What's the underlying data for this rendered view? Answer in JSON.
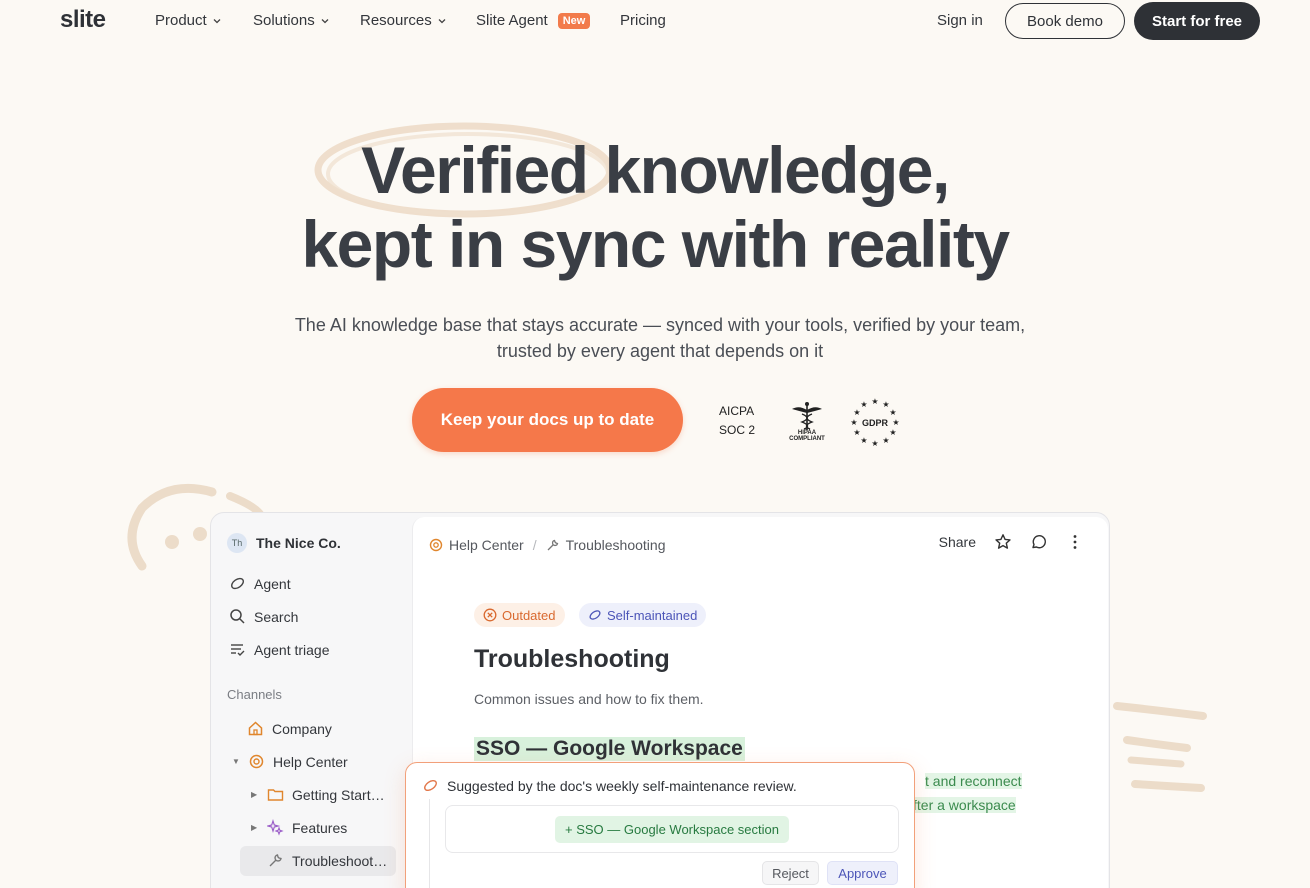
{
  "nav": {
    "logo": "slite",
    "items": [
      {
        "label": "Product",
        "dropdown": true
      },
      {
        "label": "Solutions",
        "dropdown": true
      },
      {
        "label": "Resources",
        "dropdown": true
      },
      {
        "label": "Slite Agent",
        "badge": "New"
      },
      {
        "label": "Pricing"
      }
    ],
    "sign_in": "Sign in",
    "book_demo": "Book demo",
    "start_free": "Start for free"
  },
  "hero": {
    "headline_1": "Verified knowledge,",
    "headline_2": "kept in sync with reality",
    "subtitle": "The AI knowledge base that stays accurate — synced with your tools, verified by your team, trusted by every agent that depends on it",
    "cta": "Keep your docs up to date",
    "compliance": {
      "aicpa_1": "AICPA",
      "aicpa_2": "SOC 2",
      "hipaa_1": "HIPAA",
      "hipaa_2": "COMPLIANT",
      "gdpr": "GDPR"
    }
  },
  "app": {
    "workspace": {
      "initials": "Th",
      "name": "The Nice Co."
    },
    "sidebar": {
      "agent": "Agent",
      "search": "Search",
      "triage": "Agent triage",
      "channels_header": "Channels",
      "company": "Company",
      "help_center": "Help Center",
      "getting_started": "Getting Start…",
      "features": "Features",
      "troubleshooting": "Troubleshoot…"
    },
    "breadcrumb": {
      "parent": "Help Center",
      "current": "Troubleshooting"
    },
    "toolbar": {
      "share": "Share"
    },
    "doc": {
      "badge_outdated": "Outdated",
      "badge_self": "Self-maintained",
      "title": "Troubleshooting",
      "subtitle": "Common issues and how to fix them.",
      "section": "SSO — Google Workspace",
      "line_1": "t and reconnect",
      "line_2": "fter a workspace"
    },
    "suggestion": {
      "header": "Suggested by the doc's weekly self-maintenance review.",
      "change": "+ SSO — Google Workspace section",
      "reject": "Reject",
      "approve": "Approve"
    }
  },
  "colors": {
    "accent_orange": "#f5784a",
    "dark": "#2e3136",
    "background": "#fcf9f4",
    "badge_new": "#f27b4b"
  }
}
